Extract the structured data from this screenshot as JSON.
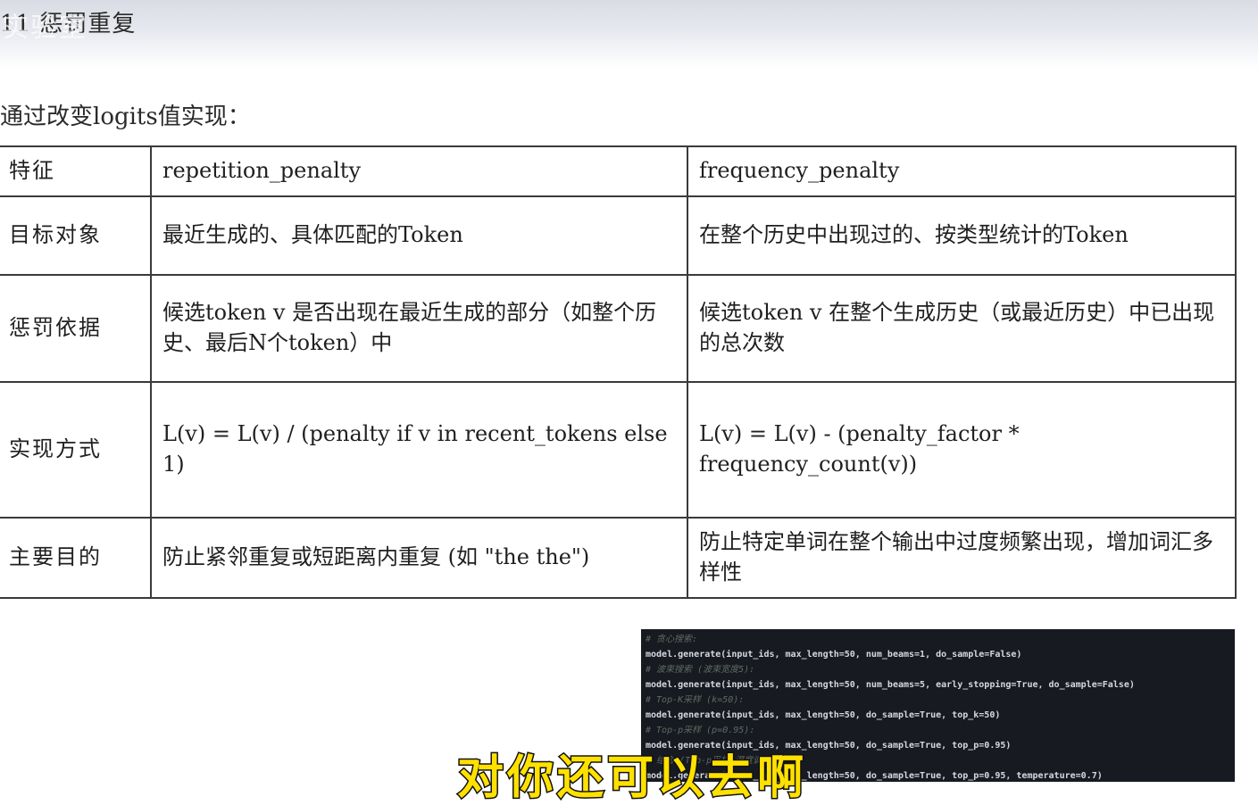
{
  "header": {
    "title": "11 惩罚重复",
    "watermark": "实验室"
  },
  "intro": "通过改变logits值实现：",
  "table": {
    "columns": [
      "特征",
      "repetition_penalty",
      "frequency_penalty"
    ],
    "rows": [
      {
        "feature": "目标对象",
        "repetition": "最近生成的、具体匹配的Token",
        "frequency": "在整个历史中出现过的、按类型统计的Token"
      },
      {
        "feature": "惩罚依据",
        "repetition": "候选token v 是否出现在最近生成的部分（如整个历史、最后N个token）中",
        "frequency": "候选token v 在整个生成历史（或最近历史）中已出现的总次数"
      },
      {
        "feature": "实现方式",
        "repetition": "L(v) = L(v) / (penalty if v in recent_tokens else 1)",
        "frequency": "L(v) = L(v) - (penalty_factor * frequency_count(v))"
      },
      {
        "feature": "主要目的",
        "repetition": "防止紧邻重复或短距离内重复 (如 \"the the\")",
        "frequency": "防止特定单词在整个输出中过度频繁出现，增加词汇多样性"
      }
    ]
  },
  "code": {
    "lines": [
      {
        "type": "comment",
        "text": "# 贪心搜索:"
      },
      {
        "type": "code",
        "text": "model.generate(input_ids, max_length=50, num_beams=1, do_sample=False)"
      },
      {
        "type": "comment",
        "text": "# 波束搜索 (波束宽度5):"
      },
      {
        "type": "code",
        "text": "model.generate(input_ids, max_length=50, num_beams=5, early_stopping=True, do_sample=False)"
      },
      {
        "type": "comment",
        "text": "# Top-K采样 (k=50):"
      },
      {
        "type": "code",
        "text": "model.generate(input_ids, max_length=50, do_sample=True, top_k=50)"
      },
      {
        "type": "comment",
        "text": "# Top-p采样 (p=0.95):"
      },
      {
        "type": "code",
        "text": "model.generate(input_ids, max_length=50, do_sample=True, top_p=0.95)"
      },
      {
        "type": "comment",
        "text": "# 组合 (Top-p采样+温度调节):"
      },
      {
        "type": "code",
        "text": "model.generate(input_ids, max_length=50, do_sample=True, top_p=0.95, temperature=0.7)"
      }
    ]
  },
  "subtitle": "对你还可以去啊"
}
